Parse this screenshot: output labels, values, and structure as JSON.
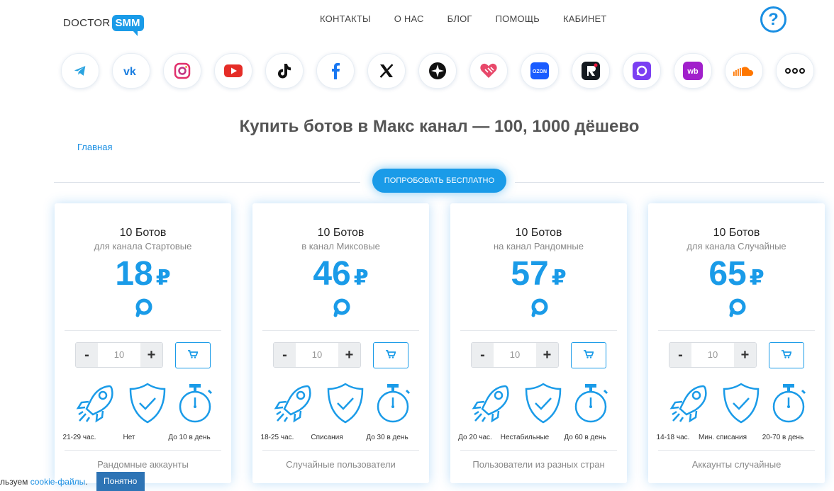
{
  "header": {
    "logo_prefix": "DOCTOR",
    "logo_badge": "SMM",
    "nav": [
      "КОНТАКТЫ",
      "О НАС",
      "БЛОГ",
      "ПОМОЩЬ",
      "КАБИНЕТ"
    ],
    "help_glyph": "?"
  },
  "socials": [
    {
      "name": "telegram-icon",
      "color": "#2aa3e0"
    },
    {
      "name": "vk-icon",
      "color": "#1a7ee0"
    },
    {
      "name": "instagram-icon",
      "color": "#e1306c"
    },
    {
      "name": "youtube-icon",
      "color": "#e52d27"
    },
    {
      "name": "tiktok-icon",
      "color": "#111111"
    },
    {
      "name": "facebook-icon",
      "color": "#1877f2"
    },
    {
      "name": "x-icon",
      "color": "#111111"
    },
    {
      "name": "max-icon",
      "color": "#111111"
    },
    {
      "name": "likee-icon",
      "color": "#e8486a"
    },
    {
      "name": "ozon-icon",
      "color": "#1a5cff"
    },
    {
      "name": "rutube-icon",
      "color": "#14191f"
    },
    {
      "name": "max-chat-icon",
      "color": "#7b3ff2"
    },
    {
      "name": "wildberries-icon",
      "color": "#a11fcb"
    },
    {
      "name": "soundcloud-icon",
      "color": "#ff7700"
    },
    {
      "name": "more-icon",
      "color": "#111111"
    }
  ],
  "page": {
    "title": "Купить ботов в Макс канал — 100, 1000 дёшево",
    "breadcrumb": "Главная",
    "try_button": "Попробовать бесплатно"
  },
  "cards": [
    {
      "title": "10 Ботов",
      "subtitle": "для канала Стартовые",
      "price": "18",
      "currency": "₽",
      "quantity": "10",
      "features": [
        "21-29 час.",
        "Нет",
        "До 10 в день"
      ],
      "footer": "Рандомные аккаунты"
    },
    {
      "title": "10 Ботов",
      "subtitle": "в канал Миксовые",
      "price": "46",
      "currency": "₽",
      "quantity": "10",
      "features": [
        "18-25 час.",
        "Списания",
        "До 30 в день"
      ],
      "footer": "Случайные пользователи"
    },
    {
      "title": "10 Ботов",
      "subtitle": "на канал Рандомные",
      "price": "57",
      "currency": "₽",
      "quantity": "10",
      "features": [
        "До 20 час.",
        "Нестабильные",
        "До 60 в день"
      ],
      "footer": "Пользователи из разных стран"
    },
    {
      "title": "10 Ботов",
      "subtitle": "для канала Случайные",
      "price": "65",
      "currency": "₽",
      "quantity": "10",
      "features": [
        "14-18 час.",
        "Мин. списания",
        "20-70 в день"
      ],
      "footer": "Аккаунты случайные"
    }
  ],
  "controls": {
    "minus": "-",
    "plus": "+"
  },
  "cookie": {
    "text": "льзуем ",
    "link": "cookie-файлы",
    "after": ".",
    "button": "Понятно"
  },
  "colors": {
    "accent": "#1a9be8",
    "cookie_button": "#2e74b5"
  }
}
